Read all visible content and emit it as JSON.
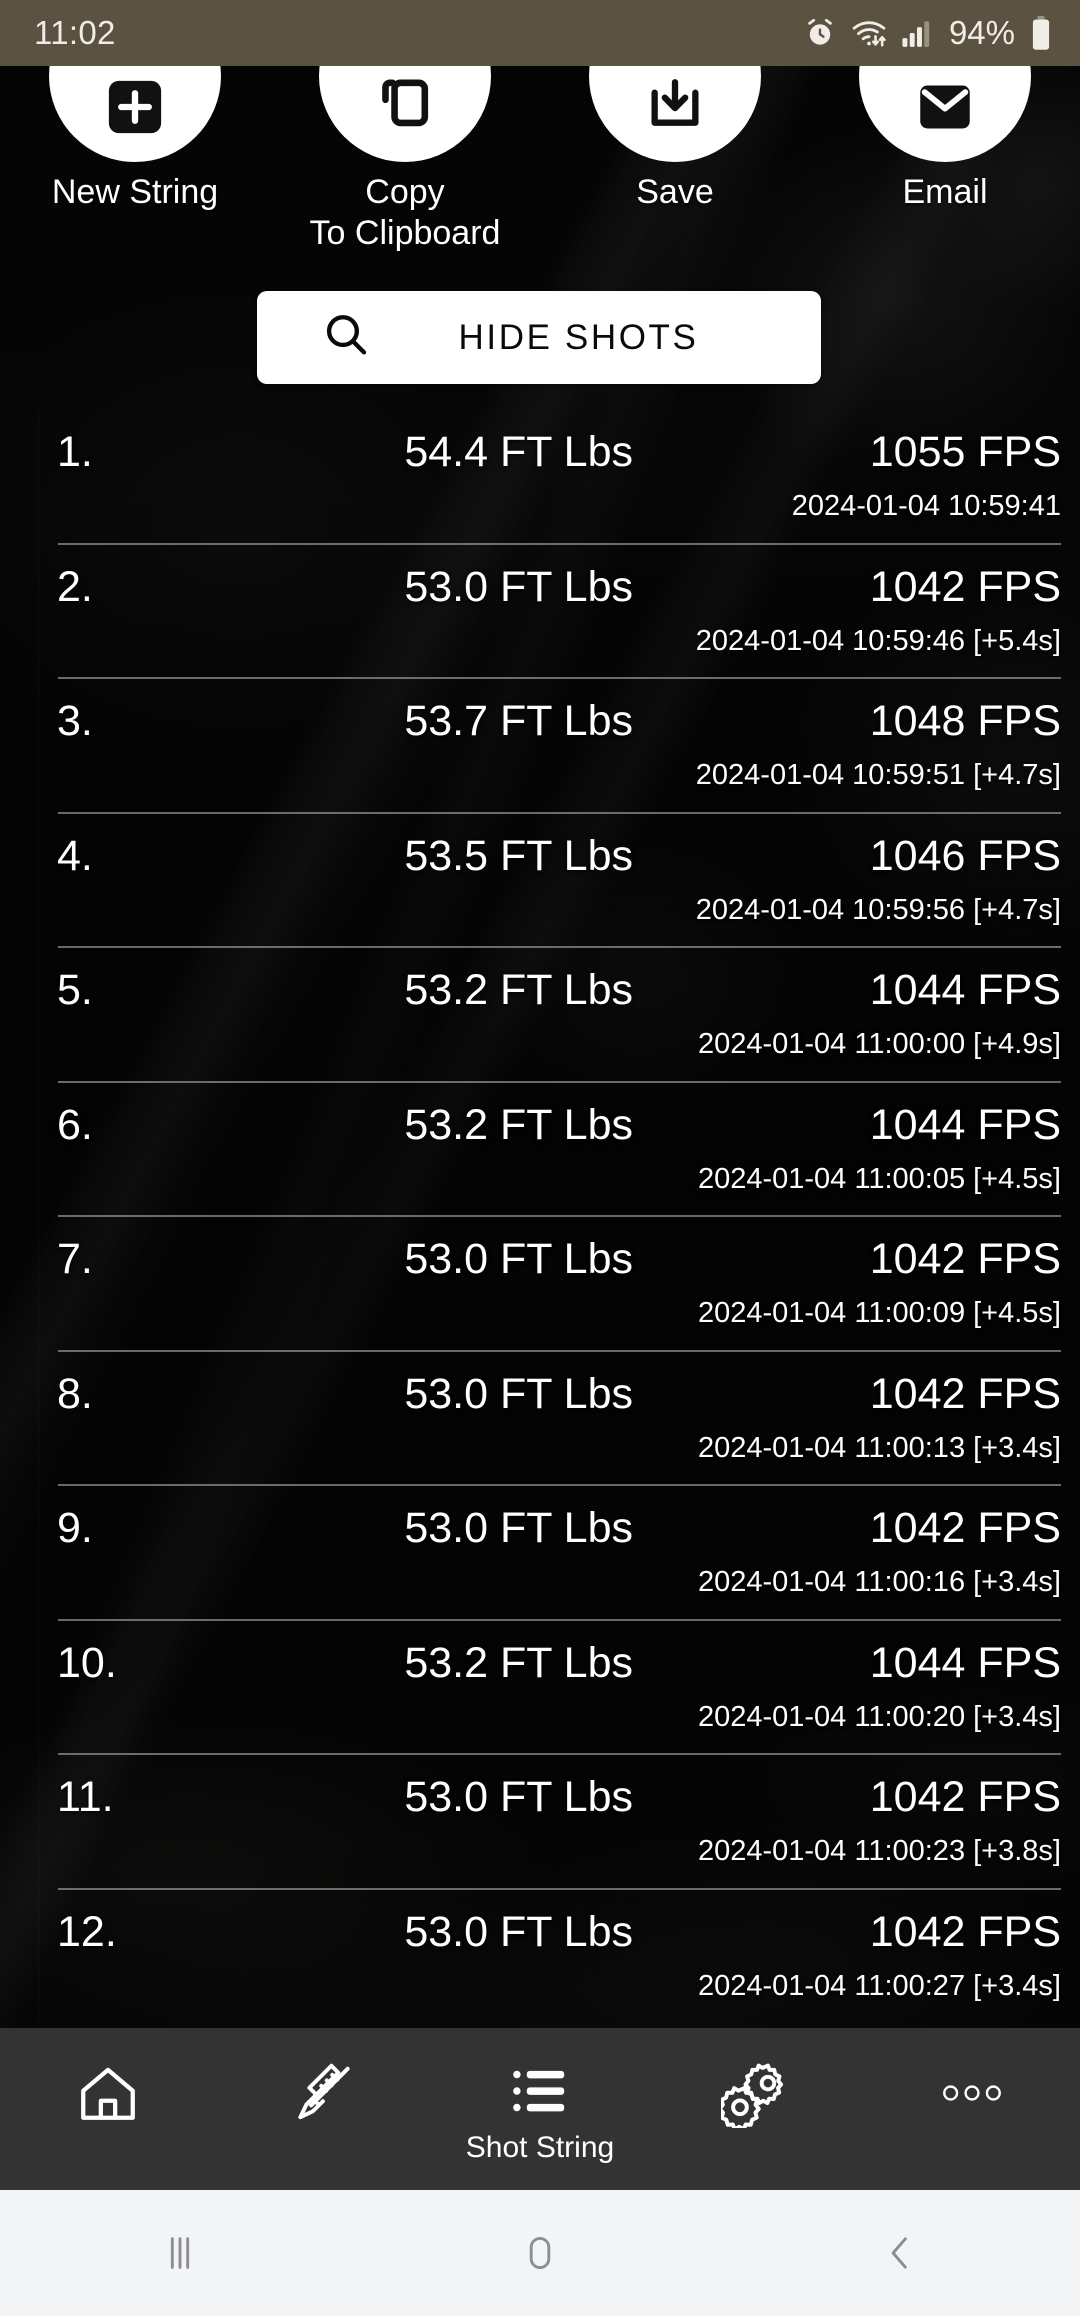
{
  "status_bar": {
    "clock": "11:02",
    "battery_percent": "94%",
    "icons": [
      "alarm-icon",
      "wifi-icon",
      "signal-icon",
      "battery-icon"
    ],
    "background_color": "#5c5241"
  },
  "toolbar": {
    "actions": [
      {
        "label": "New String",
        "icon": "add-note-icon"
      },
      {
        "label": "Copy\nTo Clipboard",
        "label_line1": "Copy",
        "label_line2": "To Clipboard",
        "icon": "copy-icon"
      },
      {
        "label": "Save",
        "icon": "save-download-icon"
      },
      {
        "label": "Email",
        "icon": "email-icon"
      }
    ]
  },
  "hide_shots": {
    "label": "HIDE SHOTS",
    "icon": "search-icon"
  },
  "shot_string": {
    "columns": [
      "index",
      "energy",
      "speed",
      "timestamp"
    ],
    "units": {
      "energy": "FT Lbs",
      "speed": "FPS"
    },
    "rows": [
      {
        "index": "1.",
        "energy": "54.4 FT Lbs",
        "speed": "1055 FPS",
        "time": "2024-01-04 10:59:41"
      },
      {
        "index": "2.",
        "energy": "53.0 FT Lbs",
        "speed": "1042 FPS",
        "time": "2024-01-04 10:59:46 [+5.4s]"
      },
      {
        "index": "3.",
        "energy": "53.7 FT Lbs",
        "speed": "1048 FPS",
        "time": "2024-01-04 10:59:51 [+4.7s]"
      },
      {
        "index": "4.",
        "energy": "53.5 FT Lbs",
        "speed": "1046 FPS",
        "time": "2024-01-04 10:59:56 [+4.7s]"
      },
      {
        "index": "5.",
        "energy": "53.2 FT Lbs",
        "speed": "1044 FPS",
        "time": "2024-01-04 11:00:00 [+4.9s]"
      },
      {
        "index": "6.",
        "energy": "53.2 FT Lbs",
        "speed": "1044 FPS",
        "time": "2024-01-04 11:00:05 [+4.5s]"
      },
      {
        "index": "7.",
        "energy": "53.0 FT Lbs",
        "speed": "1042 FPS",
        "time": "2024-01-04 11:00:09 [+4.5s]"
      },
      {
        "index": "8.",
        "energy": "53.0 FT Lbs",
        "speed": "1042 FPS",
        "time": "2024-01-04 11:00:13 [+3.4s]"
      },
      {
        "index": "9.",
        "energy": "53.0 FT Lbs",
        "speed": "1042 FPS",
        "time": "2024-01-04 11:00:16 [+3.4s]"
      },
      {
        "index": "10.",
        "energy": "53.2 FT Lbs",
        "speed": "1044 FPS",
        "time": "2024-01-04 11:00:20 [+3.4s]"
      },
      {
        "index": "11.",
        "energy": "53.0 FT Lbs",
        "speed": "1042 FPS",
        "time": "2024-01-04 11:00:23 [+3.8s]"
      },
      {
        "index": "12.",
        "energy": "53.0 FT Lbs",
        "speed": "1042 FPS",
        "time": "2024-01-04 11:00:27 [+3.4s]"
      }
    ]
  },
  "bottom_nav": {
    "background_color": "#333333",
    "items": [
      {
        "icon": "home-icon",
        "label": "",
        "active": false
      },
      {
        "icon": "rifle-icon",
        "label": "",
        "active": false
      },
      {
        "icon": "list-icon",
        "label": "Shot String",
        "active": true
      },
      {
        "icon": "gears-icon",
        "label": "",
        "active": false
      },
      {
        "icon": "more-dots-icon",
        "label": "",
        "active": false
      }
    ]
  },
  "system_nav": {
    "background_color": "#f3f4f6",
    "buttons": [
      {
        "icon": "recents-icon"
      },
      {
        "icon": "home-circle-icon"
      },
      {
        "icon": "back-icon"
      }
    ]
  }
}
